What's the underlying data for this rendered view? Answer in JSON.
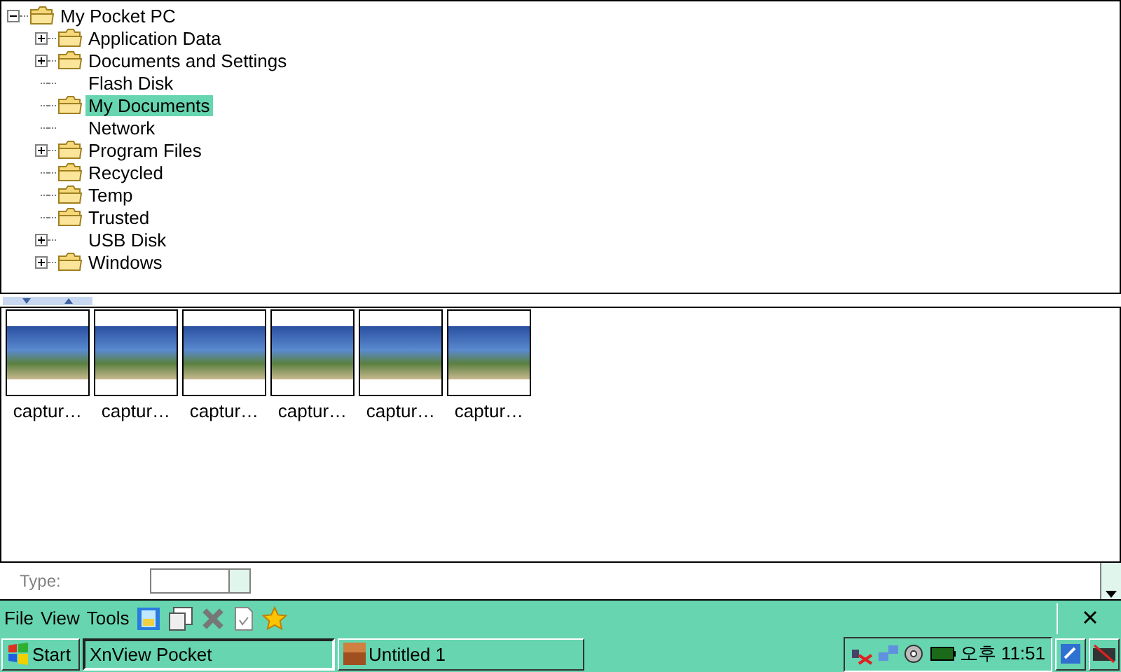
{
  "tree": {
    "label": "My Pocket PC",
    "expanded": true,
    "children": [
      {
        "label": "Application Data",
        "kind": "folder",
        "has_children": true,
        "selected": false
      },
      {
        "label": "Documents and Settings",
        "kind": "folder",
        "has_children": true,
        "selected": false
      },
      {
        "label": "Flash Disk",
        "kind": "drive",
        "has_children": false,
        "selected": false
      },
      {
        "label": "My Documents",
        "kind": "folder",
        "has_children": false,
        "selected": true
      },
      {
        "label": "Network",
        "kind": "drive",
        "has_children": false,
        "selected": false
      },
      {
        "label": "Program Files",
        "kind": "folder",
        "has_children": true,
        "selected": false
      },
      {
        "label": "Recycled",
        "kind": "folder",
        "has_children": false,
        "selected": false
      },
      {
        "label": "Temp",
        "kind": "folder",
        "has_children": false,
        "selected": false
      },
      {
        "label": "Trusted",
        "kind": "folder",
        "has_children": false,
        "selected": false
      },
      {
        "label": "USB Disk",
        "kind": "drive",
        "has_children": true,
        "selected": false
      },
      {
        "label": "Windows",
        "kind": "folder",
        "has_children": true,
        "selected": false
      }
    ]
  },
  "thumbnails": [
    {
      "label": "captur…"
    },
    {
      "label": "captur…"
    },
    {
      "label": "captur…"
    },
    {
      "label": "captur…"
    },
    {
      "label": "captur…"
    },
    {
      "label": "captur…"
    }
  ],
  "behind": {
    "label": "Type:"
  },
  "menu_bar": {
    "menus": [
      "File",
      "View",
      "Tools"
    ]
  },
  "taskbar": {
    "start": "Start",
    "tasks": [
      {
        "label": "XnView Pocket",
        "selected": true
      },
      {
        "label": "Untitled 1",
        "selected": false
      }
    ],
    "clock": "오후 11:51"
  }
}
